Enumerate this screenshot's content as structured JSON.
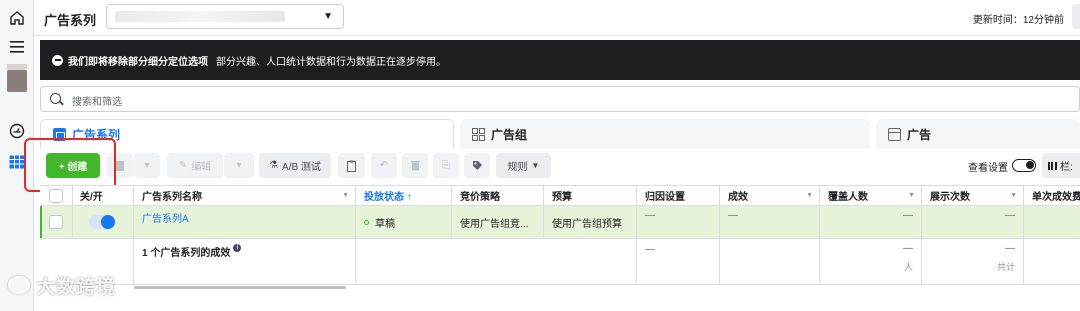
{
  "header": {
    "title": "广告系列",
    "updated": "更新时间：12分钟前"
  },
  "notice": {
    "bold": "我们即将移除部分细分定位选项",
    "text": "部分兴趣、人口统计数据和行为数据正在逐步停用。"
  },
  "search": {
    "placeholder": "搜索和筛选"
  },
  "tabs": [
    {
      "label": "广告系列"
    },
    {
      "label": "广告组"
    },
    {
      "label": "广告"
    }
  ],
  "toolbar": {
    "create": "+ 创建",
    "edit": "编辑",
    "ab_test": "A/B 测试",
    "rules": "规则",
    "view_settings": "查看设置",
    "columns": "栏:"
  },
  "table": {
    "headers": [
      "关/开",
      "广告系列名称",
      "投放状态 ↑",
      "竞价策略",
      "预算",
      "归因设置",
      "成效",
      "覆盖人数",
      "展示次数",
      "单次成效费"
    ],
    "row": {
      "name": "广告系列A",
      "status": "草稿",
      "bid": "使用广告组竞...",
      "budget": "使用广告组预算",
      "attribution": "—",
      "results": "—",
      "reach": "—",
      "impressions": "—"
    },
    "totals": {
      "label": "1 个广告系列的成效",
      "attribution": "—",
      "reach": "—",
      "reach_sub": "人",
      "impressions": "—",
      "impressions_sub": "共计"
    }
  },
  "watermark": "大数跨境"
}
